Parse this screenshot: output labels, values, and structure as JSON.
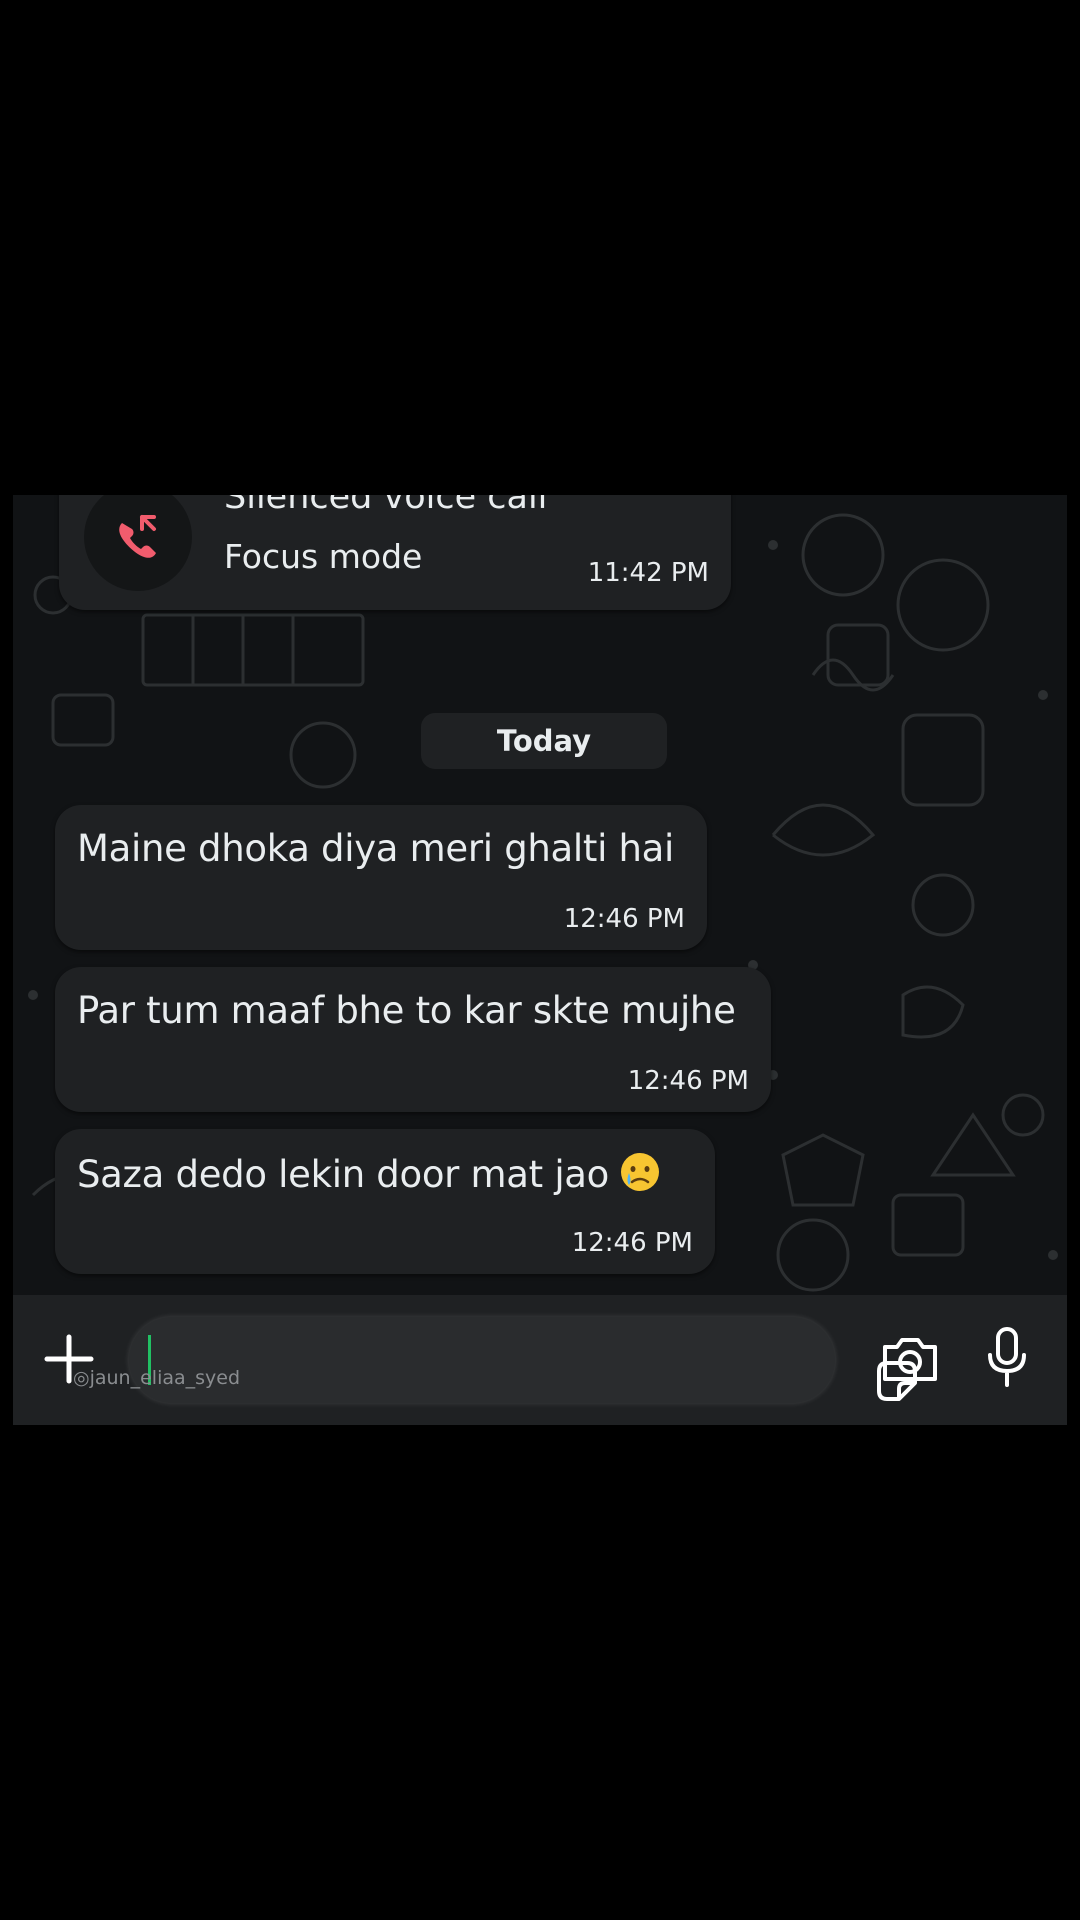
{
  "call_message": {
    "title": "Silenced voice call",
    "subtitle": "Focus mode",
    "time": "11:42 PM",
    "icon": "missed-call-icon",
    "icon_color": "#f15c6d"
  },
  "date_divider": "Today",
  "messages": [
    {
      "text": "Maine dhoka diya meri ghalti hai",
      "time": "12:46 PM"
    },
    {
      "text": "Par tum maaf bhe to kar skte mujhe",
      "time": "12:46 PM"
    },
    {
      "text": "Saza dedo lekin door mat jao",
      "time": "12:46 PM",
      "emoji": "crying-face-emoji"
    }
  ],
  "composer": {
    "watermark": "jaun_eliaa_syed",
    "watermark_icon": "instagram-icon",
    "icons": [
      "plus-icon",
      "sticker-icon",
      "camera-icon",
      "mic-icon"
    ],
    "cursor_color": "#21c063"
  }
}
